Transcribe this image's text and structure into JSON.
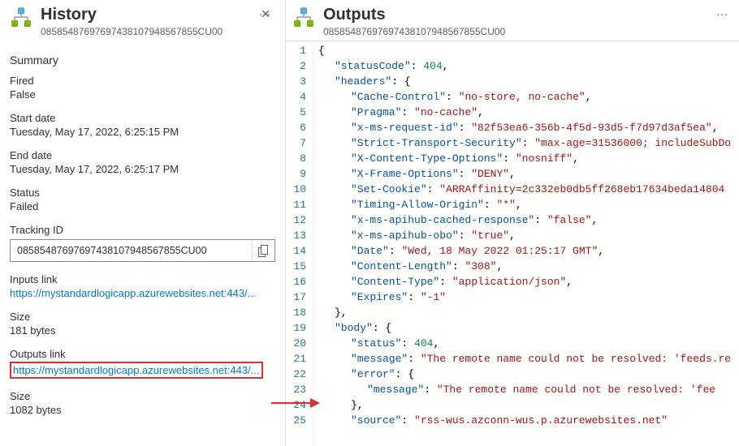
{
  "history": {
    "title": "History",
    "run_id": "08585487697697438107948567855CU00",
    "sections": {
      "summary": "Summary",
      "fired_label": "Fired",
      "fired_value": "False",
      "start_label": "Start date",
      "start_value": "Tuesday, May 17, 2022, 6:25:15 PM",
      "end_label": "End date",
      "end_value": "Tuesday, May 17, 2022, 6:25:17 PM",
      "status_label": "Status",
      "status_value": "Failed",
      "tracking_label": "Tracking ID",
      "tracking_value": "08585487697697438107948567855CU00",
      "inputs_link_label": "Inputs link",
      "inputs_link_value": "https://mystandardlogicapp.azurewebsites.net:443/...",
      "inputs_size_label": "Size",
      "inputs_size_value": "181 bytes",
      "outputs_link_label": "Outputs link",
      "outputs_link_value": "https://mystandardlogicapp.azurewebsites.net:443/...",
      "outputs_size_label": "Size",
      "outputs_size_value": "1082 bytes"
    }
  },
  "outputs": {
    "title": "Outputs",
    "run_id": "08585487697697438107948567855CU00"
  },
  "code": {
    "lines": [
      [
        [
          "p",
          "{"
        ]
      ],
      [
        [
          "i",
          2
        ],
        [
          "k",
          "\"statusCode\""
        ],
        [
          "p",
          ": "
        ],
        [
          "n",
          "404"
        ],
        [
          "p",
          ","
        ]
      ],
      [
        [
          "i",
          2
        ],
        [
          "k",
          "\"headers\""
        ],
        [
          "p",
          ": {"
        ]
      ],
      [
        [
          "i",
          4
        ],
        [
          "k",
          "\"Cache-Control\""
        ],
        [
          "p",
          ": "
        ],
        [
          "s",
          "\"no-store, no-cache\""
        ],
        [
          "p",
          ","
        ]
      ],
      [
        [
          "i",
          4
        ],
        [
          "k",
          "\"Pragma\""
        ],
        [
          "p",
          ": "
        ],
        [
          "s",
          "\"no-cache\""
        ],
        [
          "p",
          ","
        ]
      ],
      [
        [
          "i",
          4
        ],
        [
          "k",
          "\"x-ms-request-id\""
        ],
        [
          "p",
          ": "
        ],
        [
          "s",
          "\"82f53ea6-356b-4f5d-93d5-f7d97d3af5ea\""
        ],
        [
          "p",
          ","
        ]
      ],
      [
        [
          "i",
          4
        ],
        [
          "k",
          "\"Strict-Transport-Security\""
        ],
        [
          "p",
          ": "
        ],
        [
          "s",
          "\"max-age=31536000; includeSubDo"
        ]
      ],
      [
        [
          "i",
          4
        ],
        [
          "k",
          "\"X-Content-Type-Options\""
        ],
        [
          "p",
          ": "
        ],
        [
          "s",
          "\"nosniff\""
        ],
        [
          "p",
          ","
        ]
      ],
      [
        [
          "i",
          4
        ],
        [
          "k",
          "\"X-Frame-Options\""
        ],
        [
          "p",
          ": "
        ],
        [
          "s",
          "\"DENY\""
        ],
        [
          "p",
          ","
        ]
      ],
      [
        [
          "i",
          4
        ],
        [
          "k",
          "\"Set-Cookie\""
        ],
        [
          "p",
          ": "
        ],
        [
          "s",
          "\"ARRAffinity=2c332eb0db5ff268eb17634beda14804"
        ]
      ],
      [
        [
          "i",
          4
        ],
        [
          "k",
          "\"Timing-Allow-Origin\""
        ],
        [
          "p",
          ": "
        ],
        [
          "s",
          "\"*\""
        ],
        [
          "p",
          ","
        ]
      ],
      [
        [
          "i",
          4
        ],
        [
          "k",
          "\"x-ms-apihub-cached-response\""
        ],
        [
          "p",
          ": "
        ],
        [
          "s",
          "\"false\""
        ],
        [
          "p",
          ","
        ]
      ],
      [
        [
          "i",
          4
        ],
        [
          "k",
          "\"x-ms-apihub-obo\""
        ],
        [
          "p",
          ": "
        ],
        [
          "s",
          "\"true\""
        ],
        [
          "p",
          ","
        ]
      ],
      [
        [
          "i",
          4
        ],
        [
          "k",
          "\"Date\""
        ],
        [
          "p",
          ": "
        ],
        [
          "s",
          "\"Wed, 18 May 2022 01:25:17 GMT\""
        ],
        [
          "p",
          ","
        ]
      ],
      [
        [
          "i",
          4
        ],
        [
          "k",
          "\"Content-Length\""
        ],
        [
          "p",
          ": "
        ],
        [
          "s",
          "\"308\""
        ],
        [
          "p",
          ","
        ]
      ],
      [
        [
          "i",
          4
        ],
        [
          "k",
          "\"Content-Type\""
        ],
        [
          "p",
          ": "
        ],
        [
          "s",
          "\"application/json\""
        ],
        [
          "p",
          ","
        ]
      ],
      [
        [
          "i",
          4
        ],
        [
          "k",
          "\"Expires\""
        ],
        [
          "p",
          ": "
        ],
        [
          "s",
          "\"-1\""
        ]
      ],
      [
        [
          "i",
          2
        ],
        [
          "p",
          "},"
        ]
      ],
      [
        [
          "i",
          2
        ],
        [
          "k",
          "\"body\""
        ],
        [
          "p",
          ": {"
        ]
      ],
      [
        [
          "i",
          4
        ],
        [
          "k",
          "\"status\""
        ],
        [
          "p",
          ": "
        ],
        [
          "n",
          "404"
        ],
        [
          "p",
          ","
        ]
      ],
      [
        [
          "i",
          4
        ],
        [
          "k",
          "\"message\""
        ],
        [
          "p",
          ": "
        ],
        [
          "s",
          "\"The remote name could not be resolved: 'feeds.re"
        ]
      ],
      [
        [
          "i",
          4
        ],
        [
          "k",
          "\"error\""
        ],
        [
          "p",
          ": {"
        ]
      ],
      [
        [
          "i",
          6
        ],
        [
          "k",
          "\"message\""
        ],
        [
          "p",
          ": "
        ],
        [
          "s",
          "\"The remote name could not be resolved: 'fee"
        ]
      ],
      [
        [
          "i",
          4
        ],
        [
          "p",
          "},"
        ]
      ],
      [
        [
          "i",
          4
        ],
        [
          "k",
          "\"source\""
        ],
        [
          "p",
          ": "
        ],
        [
          "s",
          "\"rss-wus.azconn-wus.p.azurewebsites.net\""
        ]
      ]
    ]
  }
}
